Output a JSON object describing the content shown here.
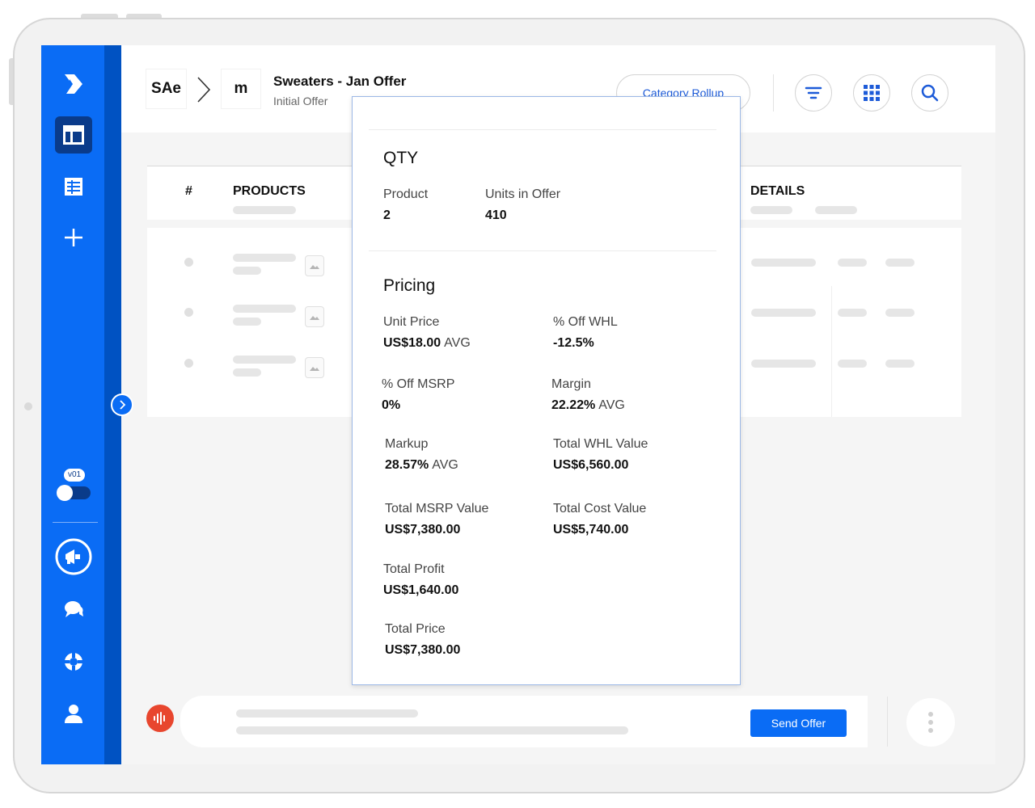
{
  "sidebar": {
    "toggle_label": "v01"
  },
  "header": {
    "crumb_1": "SAe",
    "crumb_2": "m",
    "title": "Sweaters - Jan Offer",
    "subtitle": "Initial Offer",
    "category_button": "Category Rollup"
  },
  "table": {
    "col_number": "#",
    "col_products": "PRODUCTS",
    "col_details": "DETAILS"
  },
  "footer": {
    "send_button": "Send Offer"
  },
  "popup": {
    "qty": {
      "title": "QTY",
      "product_label": "Product",
      "product_value": "2",
      "units_label": "Units in Offer",
      "units_value": "410"
    },
    "pricing": {
      "title": "Pricing",
      "unit_price_label": "Unit Price",
      "unit_price_value": "US$18.00",
      "unit_price_suffix": "AVG",
      "off_whl_label": "% Off WHL",
      "off_whl_value": "-12.5%",
      "off_msrp_label": "% Off MSRP",
      "off_msrp_value": "0%",
      "margin_label": "Margin",
      "margin_value": "22.22%",
      "margin_suffix": "AVG",
      "markup_label": "Markup",
      "markup_value": "28.57%",
      "markup_suffix": "AVG",
      "total_whl_label": "Total WHL Value",
      "total_whl_value": "US$6,560.00",
      "total_msrp_label": "Total MSRP Value",
      "total_msrp_value": "US$7,380.00",
      "total_cost_label": "Total Cost Value",
      "total_cost_value": "US$5,740.00",
      "total_profit_label": "Total Profit",
      "total_profit_value": "US$1,640.00",
      "total_price_label": "Total Price",
      "total_price_value": "US$7,380.00"
    }
  },
  "colors": {
    "brand_blue": "#0a6cf5",
    "sidebar_dark": "#0052c2",
    "mic_red": "#e8462e"
  }
}
